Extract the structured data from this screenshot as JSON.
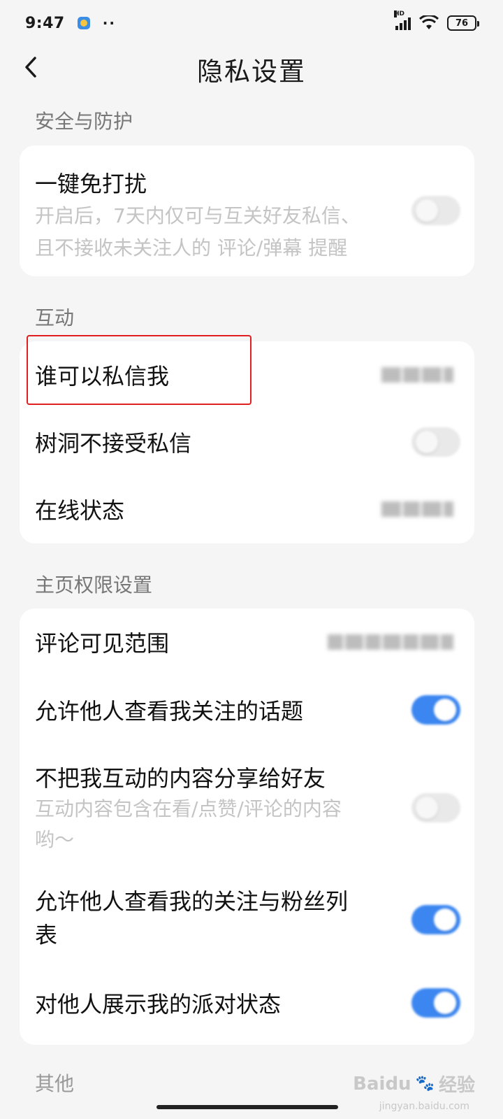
{
  "status_bar": {
    "time": "9:47",
    "dots": "··",
    "network": "HD",
    "battery": "76"
  },
  "header": {
    "title": "隐私设置"
  },
  "sections": {
    "security": {
      "label": "安全与防护"
    },
    "interaction": {
      "label": "互动"
    },
    "homepage": {
      "label": "主页权限设置"
    },
    "other": {
      "label": "其他"
    }
  },
  "security": {
    "dnd": {
      "title": "一键免打扰",
      "desc_line1": "开启后，7天内仅可与互关好友私信、",
      "desc_line2": "且不接收未关注人的 评论/弹幕 提醒",
      "toggle": "off"
    }
  },
  "interaction": {
    "who_can_dm": {
      "title": "谁可以私信我"
    },
    "treehole": {
      "title": "树洞不接受私信",
      "toggle": "off"
    },
    "online_status": {
      "title": "在线状态"
    }
  },
  "homepage": {
    "comment_scope": {
      "title": "评论可见范围"
    },
    "topics": {
      "title": "允许他人查看我关注的话题",
      "toggle": "on"
    },
    "share": {
      "title": "不把我互动的内容分享给好友",
      "desc_line1": "互动内容包含在看/点赞/评论的内容",
      "desc_line2": "哟～",
      "toggle": "off"
    },
    "follow_list": {
      "title_line1": "允许他人查看我的关注与粉丝列",
      "title_line2": "表",
      "toggle": "on"
    },
    "party_status": {
      "title": "对他人展示我的派对状态",
      "toggle": "on"
    }
  },
  "watermark": {
    "brand": "Baidu",
    "brand_cn": "经验",
    "url": "jingyan.baidu.com"
  },
  "colors": {
    "accent": "#3b86f1",
    "highlight": "#e02020",
    "background": "#f5f5f5"
  }
}
